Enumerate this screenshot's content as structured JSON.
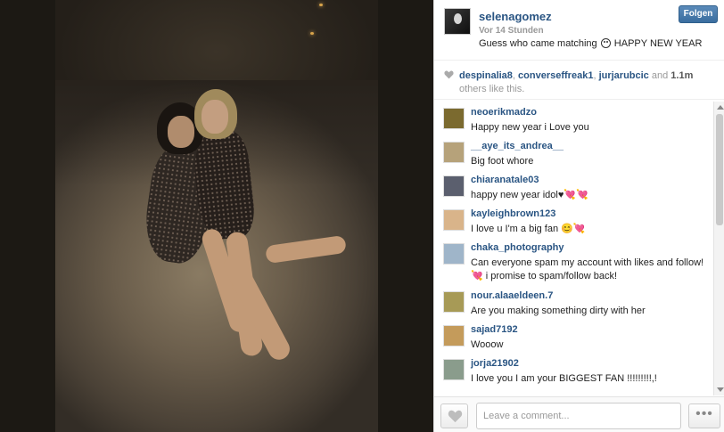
{
  "post": {
    "username": "selenagomez",
    "time": "Vor 14 Stunden",
    "caption_before": "Guess who came matching ",
    "caption_after": " HAPPY NEW YEAR",
    "follow_label": "Folgen"
  },
  "likes": {
    "users": [
      "despinalia8",
      "converseffreak1",
      "jurjarubcic"
    ],
    "sep1": ", ",
    "sep2": ", ",
    "and_text": " and ",
    "count": "1.1m",
    "suffix": " others like this."
  },
  "comments": [
    {
      "user": "neoerikmadzo",
      "text": "Happy new year i Love you",
      "avatar_color": "#7b6a2f"
    },
    {
      "user": "__aye_its_andrea__",
      "text": "Big foot whore",
      "avatar_color": "#b6a27a"
    },
    {
      "user": "chiaranatale03",
      "text": "happy new year idol♥💘💘",
      "avatar_color": "#5b5f6e"
    },
    {
      "user": "kayleighbrown123",
      "text": "I love u I'm a big fan 😊💘",
      "avatar_color": "#d9b48a"
    },
    {
      "user": "chaka_photography",
      "text": "Can everyone spam my account with likes and follow!💘 i promise to spam/follow back!",
      "avatar_color": "#9fb5c9"
    },
    {
      "user": "nour.alaaeldeen.7",
      "text": "Are you making something dirty with her",
      "avatar_color": "#a79a56"
    },
    {
      "user": "sajad7192",
      "text": "Wooow",
      "avatar_color": "#c49b5b"
    },
    {
      "user": "jorja21902",
      "text": "I love you I am your BIGGEST FAN !!!!!!!!!,!",
      "avatar_color": "#8a9c8c"
    }
  ],
  "footer": {
    "comment_placeholder": "Leave a comment...",
    "more_label": "•••"
  },
  "colors": {
    "link": "#2a5583",
    "follow": "#3a6d9f"
  }
}
